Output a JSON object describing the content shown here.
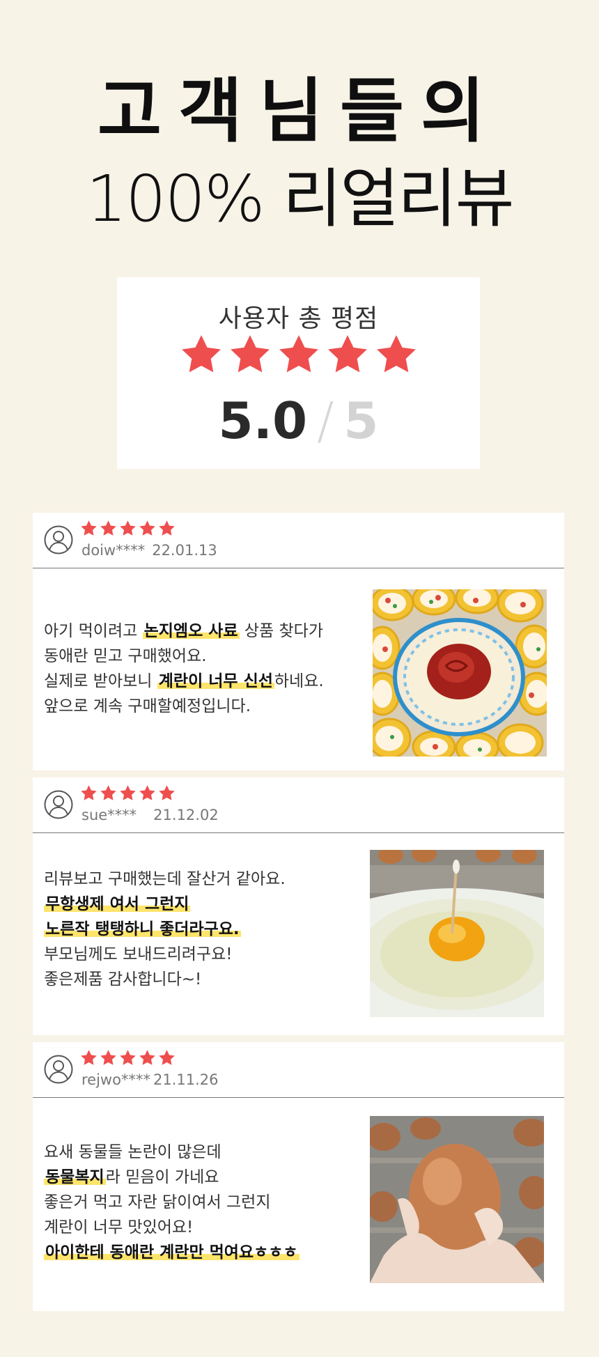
{
  "hero": {
    "title_line1": "고객님들의",
    "title_line2": "100% 리얼리뷰"
  },
  "rating": {
    "label": "사용자 총 평점",
    "stars": 5,
    "score": "5.0",
    "separator": "/",
    "max": "5"
  },
  "colors": {
    "background": "#f8f3e7",
    "star": "#ef4e4e",
    "highlight": "#fde46b"
  },
  "reviews": [
    {
      "stars": 5,
      "user": "doiw****",
      "date": "22.01.13",
      "text": {
        "l1a": "아기 먹이려고 ",
        "l1b": "논지엠오 사료",
        "l1c": " 상품 찾다가",
        "l2": "동애란 믿고 구매했어요.",
        "l3a": "실제로 받아보니 ",
        "l3b": "계란이 너무 신선",
        "l3c": "하네요.",
        "l4": "앞으로  계속 구매할예정입니다."
      },
      "photo_icon": "egg-roll-photo"
    },
    {
      "stars": 5,
      "user": "sue****",
      "date": "21.12.02",
      "text": {
        "l1": "리뷰보고 구매했는데 잘산거 같아요.",
        "l2": "무항생제 여서 그런지",
        "l3": "노른작 탱탱하니 좋더라구요.",
        "l4": "부모님께도 보내드리려구요!",
        "l5": "좋은제품 감사합니다~!"
      },
      "photo_icon": "raw-egg-yolk-photo"
    },
    {
      "stars": 5,
      "user": "rejwo****",
      "date": "21.11.26",
      "text": {
        "l1": "요새 동물들 논란이 많은데",
        "l2a": "동물복지",
        "l2b": "라 믿음이 가네요",
        "l3": "좋은거 먹고 자란 닭이여서 그런지",
        "l4": "계란이 너무 맛있어요!",
        "l5": "아이한테 동애란 계란만 먹여요ㅎㅎㅎ"
      },
      "photo_icon": "hand-holding-egg-photo"
    }
  ]
}
